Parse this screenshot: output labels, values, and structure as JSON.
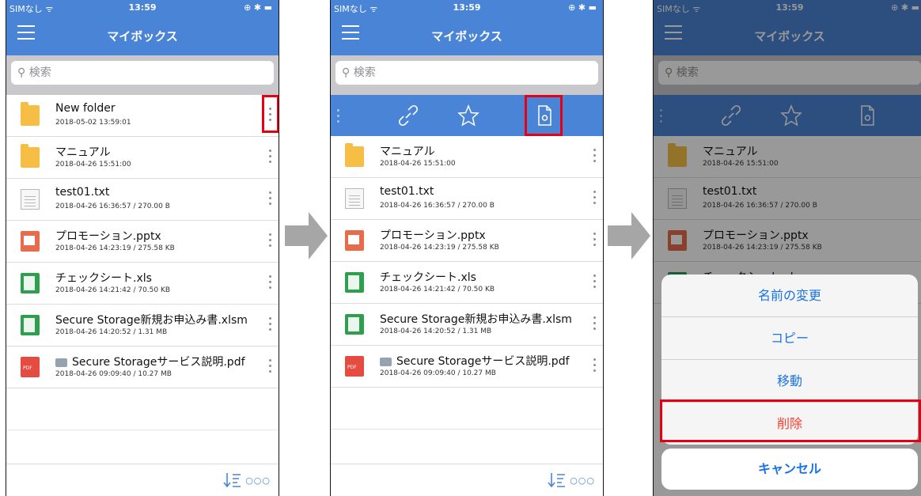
{
  "status": {
    "carrier": "SIMなし ᯤ",
    "time": "13:59",
    "right_icons": "⊕ ✱ ▬"
  },
  "nav": {
    "title": "マイボックス"
  },
  "search": {
    "placeholder": "検索"
  },
  "files": [
    {
      "name": "New folder",
      "meta": "2018-05-02 13:59:01",
      "type": "folder"
    },
    {
      "name": "マニュアル",
      "meta": "2018-04-26 15:51:00",
      "type": "folder"
    },
    {
      "name": "test01.txt",
      "meta": "2018-04-26 16:36:57 / 270.00 B",
      "type": "text"
    },
    {
      "name": "プロモーション.pptx",
      "meta": "2018-04-26 14:23:19 / 275.58 KB",
      "type": "pptx"
    },
    {
      "name": "チェックシート.xls",
      "meta": "2018-04-26 14:21:42 / 70.50 KB",
      "type": "xls"
    },
    {
      "name": "Secure Storage新規お申込み書.xlsm",
      "meta": "2018-04-26 14:20:52 / 1.31 MB",
      "type": "xlsm"
    },
    {
      "name": "Secure Storageサービス説明.pdf",
      "meta": "2018-04-26 09:09:40 / 10.27 MB",
      "type": "pdf"
    }
  ],
  "action_bar_icons": [
    "link-icon",
    "star-icon",
    "file-settings-icon"
  ],
  "bottom_bar": {
    "more": "○○○"
  },
  "sheet": {
    "options": [
      "名前の変更",
      "コピー",
      "移動",
      "削除"
    ],
    "cancel": "キャンセル"
  },
  "colors": {
    "nav_blue": "#4a84d6",
    "highlight_red": "#e50012",
    "destructive": "#ff3b30",
    "action_blue": "#1a73e8"
  }
}
